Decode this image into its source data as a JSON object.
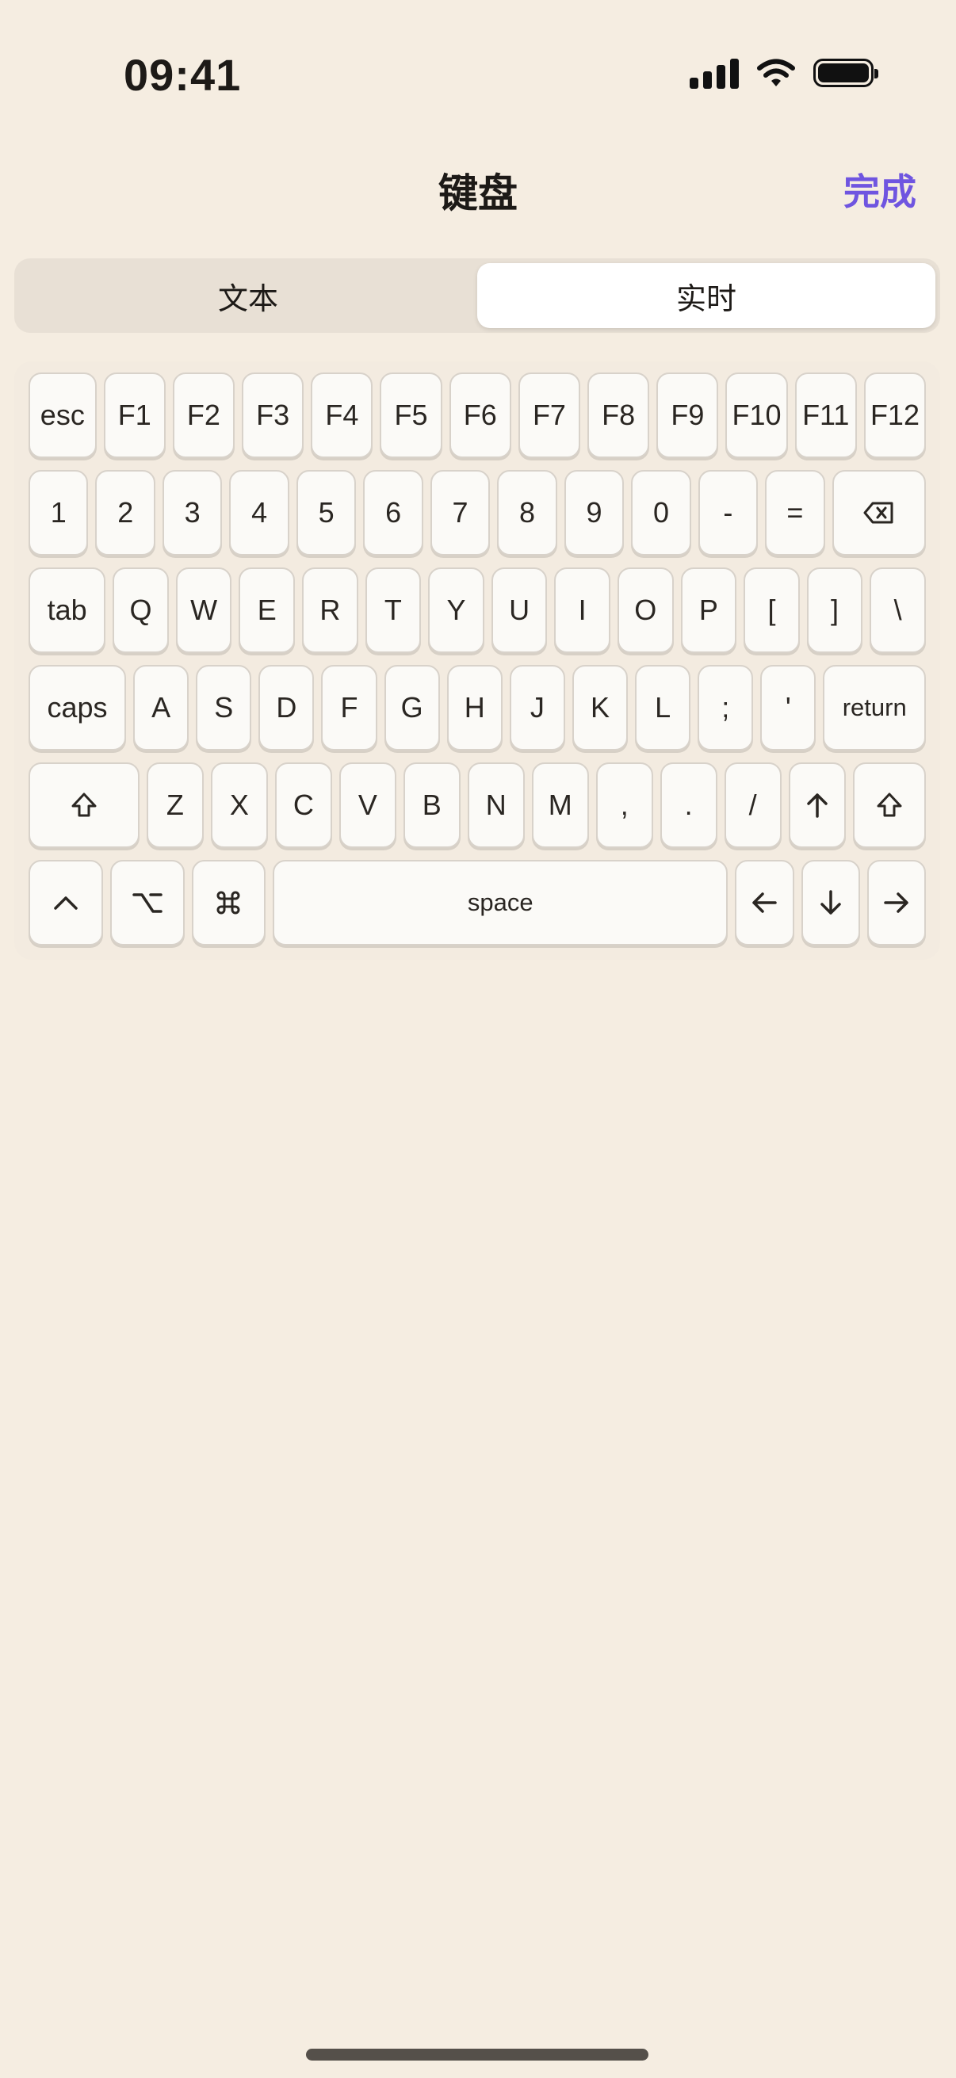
{
  "status_bar": {
    "time": "09:41"
  },
  "nav": {
    "title": "键盘",
    "done_label": "完成"
  },
  "segmented": {
    "options": [
      "文本",
      "实时"
    ],
    "selected": "实时"
  },
  "keyboard": {
    "rows": [
      [
        {
          "label": "esc",
          "flex": 1.1
        },
        {
          "label": "F1",
          "flex": 1
        },
        {
          "label": "F2",
          "flex": 1
        },
        {
          "label": "F3",
          "flex": 1
        },
        {
          "label": "F4",
          "flex": 1
        },
        {
          "label": "F5",
          "flex": 1
        },
        {
          "label": "F6",
          "flex": 1
        },
        {
          "label": "F7",
          "flex": 1
        },
        {
          "label": "F8",
          "flex": 1
        },
        {
          "label": "F9",
          "flex": 1
        },
        {
          "label": "F10",
          "flex": 1
        },
        {
          "label": "F11",
          "flex": 1
        },
        {
          "label": "F12",
          "flex": 1
        }
      ],
      [
        {
          "label": "1",
          "flex": 1
        },
        {
          "label": "2",
          "flex": 1
        },
        {
          "label": "3",
          "flex": 1
        },
        {
          "label": "4",
          "flex": 1
        },
        {
          "label": "5",
          "flex": 1
        },
        {
          "label": "6",
          "flex": 1
        },
        {
          "label": "7",
          "flex": 1
        },
        {
          "label": "8",
          "flex": 1
        },
        {
          "label": "9",
          "flex": 1
        },
        {
          "label": "0",
          "flex": 1
        },
        {
          "label": "-",
          "flex": 1
        },
        {
          "label": "=",
          "flex": 1
        },
        {
          "label": "",
          "icon": "delete-icon",
          "flex": 1.6
        }
      ],
      [
        {
          "label": "tab",
          "flex": 1.4
        },
        {
          "label": "Q",
          "flex": 1
        },
        {
          "label": "W",
          "flex": 1
        },
        {
          "label": "E",
          "flex": 1
        },
        {
          "label": "R",
          "flex": 1
        },
        {
          "label": "T",
          "flex": 1
        },
        {
          "label": "Y",
          "flex": 1
        },
        {
          "label": "U",
          "flex": 1
        },
        {
          "label": "I",
          "flex": 1
        },
        {
          "label": "O",
          "flex": 1
        },
        {
          "label": "P",
          "flex": 1
        },
        {
          "label": "[",
          "flex": 1
        },
        {
          "label": "]",
          "flex": 1
        },
        {
          "label": "\\",
          "flex": 1
        }
      ],
      [
        {
          "label": "caps",
          "flex": 1.8
        },
        {
          "label": "A",
          "flex": 1
        },
        {
          "label": "S",
          "flex": 1
        },
        {
          "label": "D",
          "flex": 1
        },
        {
          "label": "F",
          "flex": 1
        },
        {
          "label": "G",
          "flex": 1
        },
        {
          "label": "H",
          "flex": 1
        },
        {
          "label": "J",
          "flex": 1
        },
        {
          "label": "K",
          "flex": 1
        },
        {
          "label": "L",
          "flex": 1
        },
        {
          "label": ";",
          "flex": 1
        },
        {
          "label": "'",
          "flex": 1
        },
        {
          "label": "return",
          "flex": 1.9,
          "small": true
        }
      ],
      [
        {
          "label": "",
          "icon": "shift-icon",
          "flex": 2
        },
        {
          "label": "Z",
          "flex": 1
        },
        {
          "label": "X",
          "flex": 1
        },
        {
          "label": "C",
          "flex": 1
        },
        {
          "label": "V",
          "flex": 1
        },
        {
          "label": "B",
          "flex": 1
        },
        {
          "label": "N",
          "flex": 1
        },
        {
          "label": "M",
          "flex": 1
        },
        {
          "label": ",",
          "flex": 1
        },
        {
          "label": ".",
          "flex": 1
        },
        {
          "label": "/",
          "flex": 1
        },
        {
          "label": "",
          "icon": "arrow-up-icon",
          "flex": 1
        },
        {
          "label": "",
          "icon": "shift-icon",
          "flex": 1.3
        }
      ],
      [
        {
          "label": "",
          "icon": "control-icon",
          "flex": 1.15
        },
        {
          "label": "",
          "icon": "option-icon",
          "flex": 1.15
        },
        {
          "label": "",
          "icon": "command-icon",
          "flex": 1.15
        },
        {
          "label": "space",
          "flex": 7.3,
          "small": true
        },
        {
          "label": "",
          "icon": "arrow-left-icon",
          "flex": 0.9
        },
        {
          "label": "",
          "icon": "arrow-down-icon",
          "flex": 0.9
        },
        {
          "label": "",
          "icon": "arrow-right-icon",
          "flex": 0.9
        }
      ]
    ]
  },
  "colors": {
    "background": "#f5ede1",
    "accent": "#6f55e0",
    "key_face": "#fbfaf7"
  }
}
